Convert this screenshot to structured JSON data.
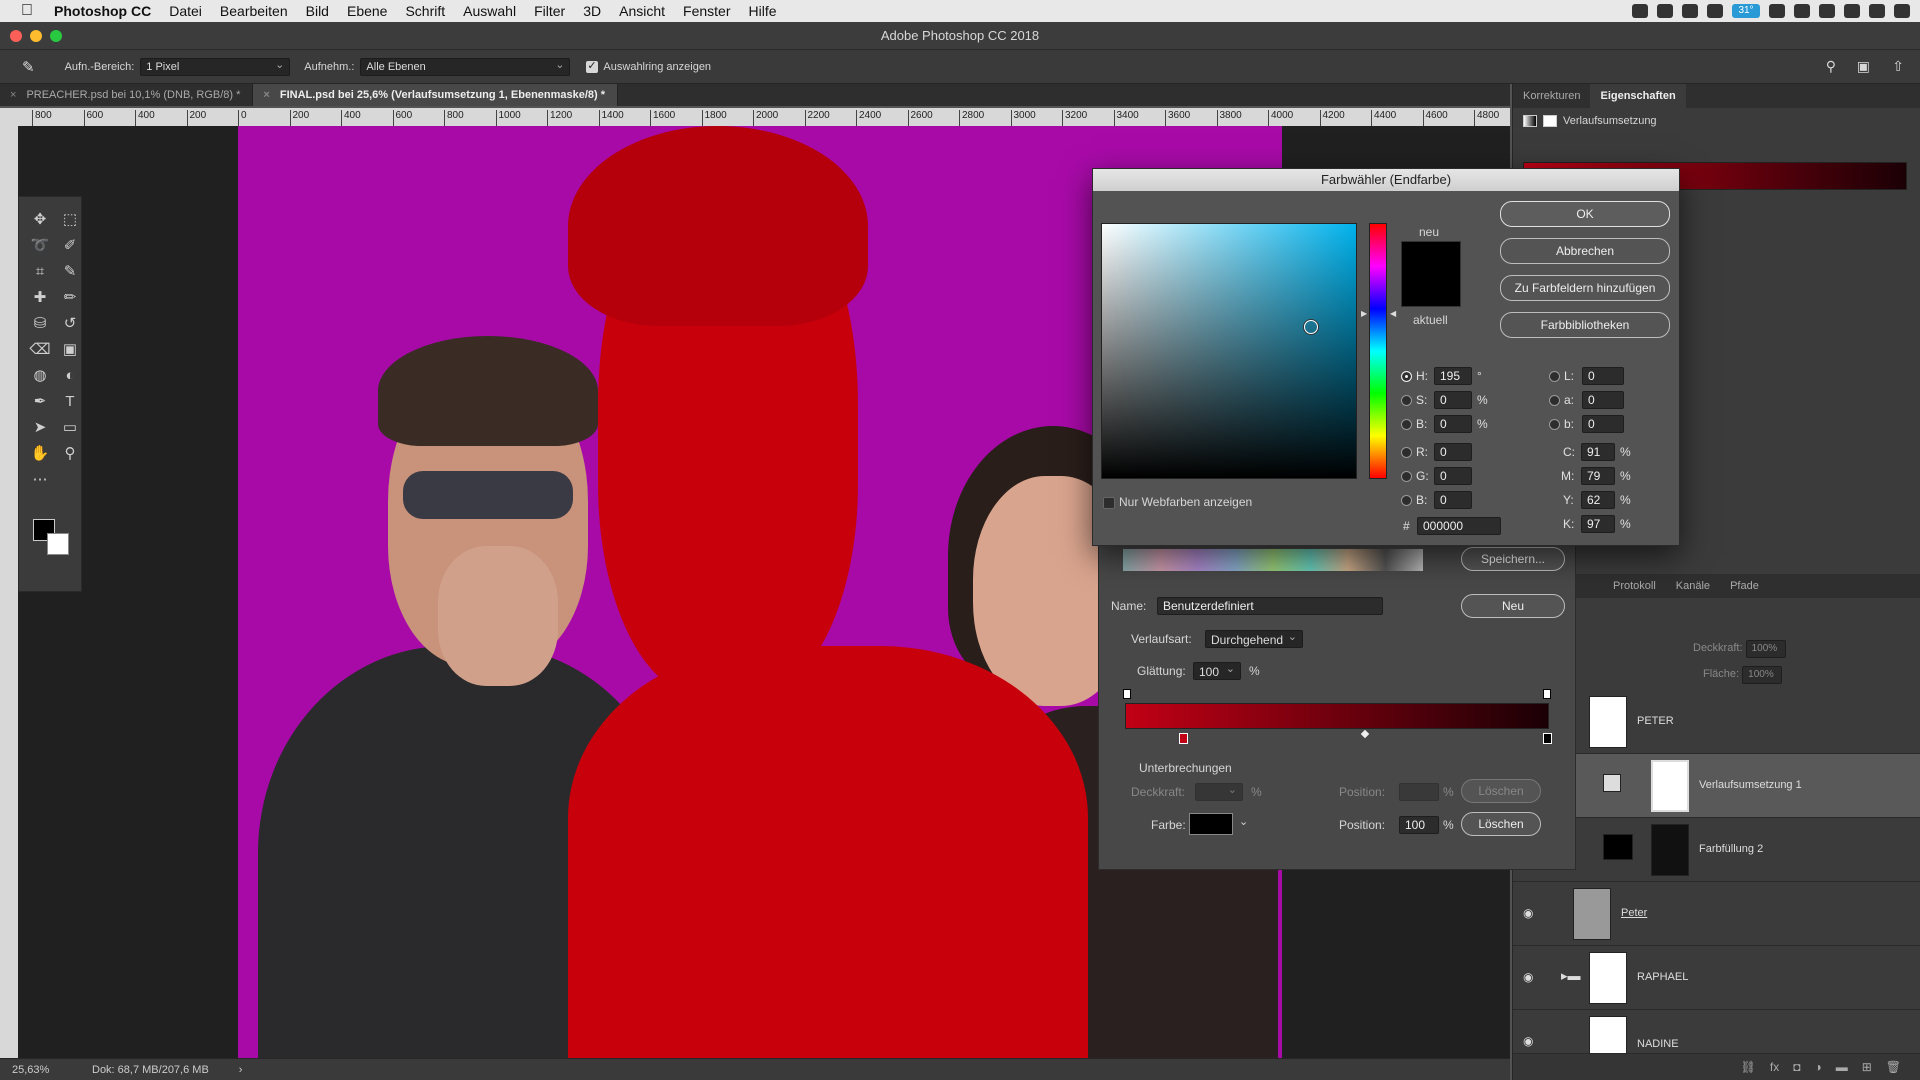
{
  "menubar": {
    "app": "Photoshop CC",
    "items": [
      "Datei",
      "Bearbeiten",
      "Bild",
      "Ebene",
      "Schrift",
      "Auswahl",
      "Filter",
      "3D",
      "Ansicht",
      "Fenster",
      "Hilfe"
    ],
    "battery": "31°"
  },
  "window": {
    "title": "Adobe Photoshop CC 2018"
  },
  "options": {
    "sample_size_label": "Aufn.-Bereich:",
    "sample_size_value": "1 Pixel",
    "sample_label": "Aufnehm.:",
    "sample_value": "Alle Ebenen",
    "show_ring_label": "Auswahlring anzeigen"
  },
  "tabs": [
    {
      "label": "PREACHER.psd bei 10,1% (DNB, RGB/8) *",
      "active": false
    },
    {
      "label": "FINAL.psd bei 25,6% (Verlaufsumsetzung 1, Ebenenmaske/8) *",
      "active": true
    }
  ],
  "ruler_ticks": [
    "800",
    "600",
    "400",
    "200",
    "0",
    "200",
    "400",
    "600",
    "800",
    "1000",
    "1200",
    "1400",
    "1600",
    "1800",
    "2000",
    "2200",
    "2400",
    "2600",
    "2800",
    "3000",
    "3200",
    "3400",
    "3600",
    "3800",
    "4000",
    "4200",
    "4400",
    "4600",
    "4800"
  ],
  "status": {
    "zoom": "25,63%",
    "doc": "Dok: 68,7 MB/207,6 MB"
  },
  "right_panel": {
    "tabs": [
      "Korrekturen",
      "Eigenschaften"
    ],
    "property_title": "Verlaufsumsetzung",
    "layer_tabs": [
      "Protokoll",
      "Kanäle",
      "Pfade"
    ],
    "opacity_label": "Deckkraft:",
    "opacity_value": "100%",
    "fill_label": "Fläche:",
    "fill_value": "100%",
    "layers": [
      {
        "name": "PETER"
      },
      {
        "name": "Verlaufsumsetzung 1"
      },
      {
        "name": "Farbfüllung 2"
      },
      {
        "name": "Peter"
      },
      {
        "name": "RAPHAEL"
      },
      {
        "name": "NADINE"
      }
    ]
  },
  "gradient_editor": {
    "save_button": "Speichern...",
    "name_label": "Name:",
    "name_value": "Benutzerdefiniert",
    "new_button": "Neu",
    "type_label": "Verlaufsart:",
    "type_value": "Durchgehend",
    "smooth_label": "Glättung:",
    "smooth_value": "100",
    "percent": "%",
    "stops_title": "Unterbrechungen",
    "opacity_label": "Deckkraft:",
    "color_label": "Farbe:",
    "position_label": "Position:",
    "position_value": "100",
    "delete_button": "Löschen"
  },
  "color_picker": {
    "title": "Farbwähler (Endfarbe)",
    "new_label": "neu",
    "current_label": "aktuell",
    "web_only_label": "Nur Webfarben anzeigen",
    "buttons": {
      "ok": "OK",
      "cancel": "Abbrechen",
      "add_swatch": "Zu Farbfeldern hinzufügen",
      "libraries": "Farbbibliotheken"
    },
    "hsb": {
      "h_label": "H:",
      "h": "195",
      "h_unit": "°",
      "s_label": "S:",
      "s": "0",
      "b_label": "B:",
      "b": "0"
    },
    "rgb": {
      "r_label": "R:",
      "r": "0",
      "g_label": "G:",
      "g": "0",
      "b_label": "B:",
      "b": "0"
    },
    "lab": {
      "l_label": "L:",
      "l": "0",
      "a_label": "a:",
      "a": "0",
      "b_label": "b:",
      "b": "0"
    },
    "cmyk": {
      "c_label": "C:",
      "c": "91",
      "m_label": "M:",
      "m": "79",
      "y_label": "Y:",
      "y": "62",
      "k_label": "K:",
      "k": "97"
    },
    "hex_label": "#",
    "hex": "000000"
  },
  "colors": {
    "canvas_bg": "#a80aa8",
    "red_overlay": "#c8000c",
    "gradient_start": "#c20015",
    "gradient_end": "#1a0005"
  }
}
